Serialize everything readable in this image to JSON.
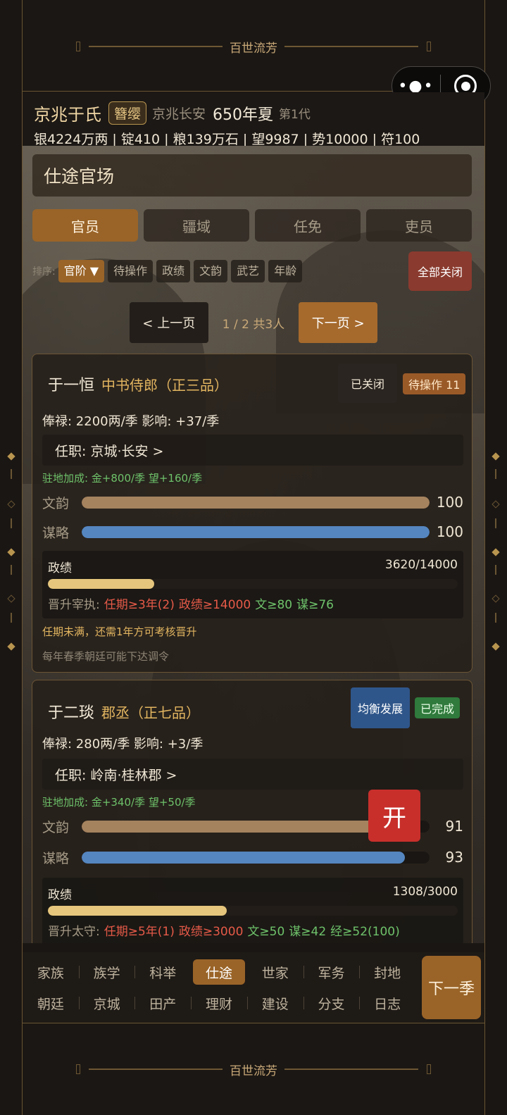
{
  "banner_text": "百世流芳",
  "header": {
    "family": "京兆于氏",
    "rank": "簪缨",
    "location": "京兆长安",
    "date": "650年夏",
    "generation": "第1代",
    "resources": "银4224万两 | 锭410 | 粮139万石 | 望9987 | 势10000 | 符100"
  },
  "section_title": "仕途官场",
  "tabs": [
    "官员",
    "疆域",
    "任免",
    "吏员"
  ],
  "sort": {
    "label": "排序:",
    "options": [
      "官阶 ▼",
      "待操作",
      "政绩",
      "文韵",
      "武艺",
      "年龄"
    ],
    "close_all": "全部关闭"
  },
  "pager": {
    "prev": "< 上一页",
    "info": "1 / 2  共3人",
    "next": "下一页 >"
  },
  "cards": [
    {
      "name": "于一恒",
      "post": "中书侍郎（正三品）",
      "badge_a": "已关闭",
      "badge_b": "待操作 11",
      "stats": "俸禄: 2200两/季   影响: +37/季",
      "office": "任职: 京城·长安  >",
      "bonus": "驻地加成: 金+800/季  望+160/季",
      "attrs": [
        {
          "label": "文韵",
          "value": "100",
          "pct": 100
        },
        {
          "label": "谋略",
          "value": "100",
          "pct": 100
        }
      ],
      "perf_label": "政绩",
      "perf_value": "3620/14000",
      "perf_pct": 25.9,
      "promo_label": "晋升宰执:",
      "promo_reqs": [
        {
          "text": "任期≥3年(2)",
          "ok": false
        },
        {
          "text": "政绩≥14000",
          "ok": false
        },
        {
          "text": "文≥80",
          "ok": true
        },
        {
          "text": "谋≥76",
          "ok": true
        }
      ],
      "note1": "任期未满，还需1年方可考核晋升",
      "note2": "每年春季朝廷可能下达调令"
    },
    {
      "name": "于二琰",
      "post": "郡丞（正七品）",
      "badge_a": "均衡发展",
      "badge_b": "已完成",
      "stats": "俸禄: 280两/季   影响: +3/季",
      "office": "任职: 岭南·桂林郡  >",
      "bonus": "驻地加成: 金+340/季  望+50/季",
      "attrs": [
        {
          "label": "文韵",
          "value": "91",
          "pct": 91
        },
        {
          "label": "谋略",
          "value": "93",
          "pct": 93
        }
      ],
      "perf_label": "政绩",
      "perf_value": "1308/3000",
      "perf_pct": 43.6,
      "promo_label": "晋升太守:",
      "promo_reqs": [
        {
          "text": "任期≥5年(1)",
          "ok": false
        },
        {
          "text": "政绩≥3000",
          "ok": false
        },
        {
          "text": "文≥50",
          "ok": true
        },
        {
          "text": "谋≥42",
          "ok": true
        },
        {
          "text": "经≥52(100)",
          "ok": true
        }
      ]
    }
  ],
  "open_button": "开",
  "nav": {
    "row1": [
      "家族",
      "族学",
      "科举",
      "仕途",
      "世家",
      "军务",
      "封地"
    ],
    "row2": [
      "朝廷",
      "京城",
      "田产",
      "理财",
      "建设",
      "分支",
      "日志"
    ],
    "active": "仕途",
    "next_season": "下一季"
  },
  "colors": {
    "accent": "#9a6428",
    "wenyun_bar": "#a5835f",
    "moulue_bar": "#5586c0",
    "perf_bar": "#e6c67d",
    "req_fail": "#e65a48",
    "req_ok": "#6ec26a"
  }
}
